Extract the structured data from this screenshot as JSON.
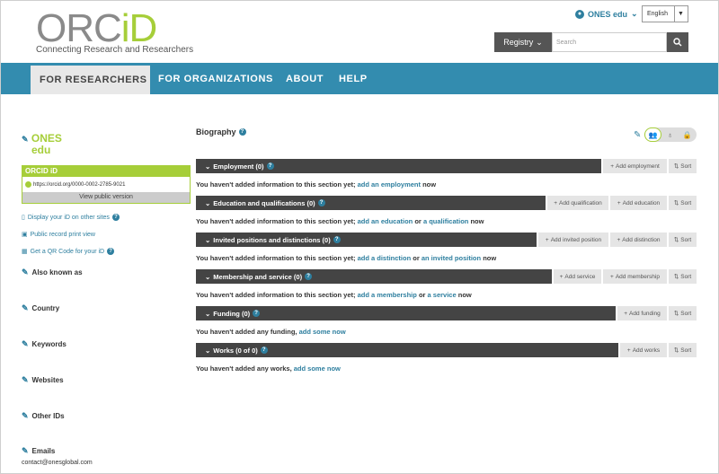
{
  "header": {
    "logo_text_gray": "ORC",
    "logo_text_green": "iD",
    "tagline": "Connecting Research and Researchers",
    "user_name": "ONES edu",
    "language": "English",
    "registry_label": "Registry",
    "search_placeholder": "Search"
  },
  "nav": {
    "items": [
      "FOR RESEARCHERS",
      "FOR ORGANIZATIONS",
      "ABOUT",
      "HELP"
    ]
  },
  "sidebar": {
    "name_line1": "ONES",
    "name_line2": "edu",
    "orcid_title": "ORCID iD",
    "orcid_url": "https://orcid.org/0000-0002-2785-9021",
    "view_public": "View public version",
    "links": [
      "Display your iD on other sites",
      "Public record print view",
      "Get a QR Code for your iD"
    ],
    "sections": [
      "Also known as",
      "Country",
      "Keywords",
      "Websites",
      "Other IDs",
      "Emails"
    ],
    "email": "contact@onesglobal.com"
  },
  "main": {
    "biography": "Biography",
    "sections": [
      {
        "title": "Employment (0)",
        "btns": [
          "Add employment",
          "Sort"
        ],
        "msg_prefix": "You haven't added information to this section yet; ",
        "link1": "add an employment",
        "mid": "",
        "link2": "",
        "suffix": " now"
      },
      {
        "title": "Education and qualifications (0)",
        "btns": [
          "Add qualification",
          "Add education",
          "Sort"
        ],
        "msg_prefix": "You haven't added information to this section yet; ",
        "link1": "add an education",
        "mid": " or ",
        "link2": "a qualification",
        "suffix": " now"
      },
      {
        "title": "Invited positions and distinctions (0)",
        "btns": [
          "Add invited position",
          "Add distinction",
          "Sort"
        ],
        "msg_prefix": "You haven't added information to this section yet; ",
        "link1": "add a distinction",
        "mid": " or ",
        "link2": "an invited position",
        "suffix": " now"
      },
      {
        "title": "Membership and service (0)",
        "btns": [
          "Add service",
          "Add membership",
          "Sort"
        ],
        "msg_prefix": "You haven't added information to this section yet; ",
        "link1": "add a membership",
        "mid": " or ",
        "link2": "a service",
        "suffix": " now"
      },
      {
        "title": "Funding (0)",
        "btns": [
          "Add funding",
          "Sort"
        ],
        "msg_prefix": "You haven't added any funding, ",
        "link1": "add some now",
        "mid": "",
        "link2": "",
        "suffix": ""
      },
      {
        "title": "Works (0 of 0)",
        "btns": [
          "Add works",
          "Sort"
        ],
        "msg_prefix": "You haven't added any works, ",
        "link1": "add some now",
        "mid": "",
        "link2": "",
        "suffix": ""
      }
    ]
  },
  "colors": {
    "brand_green": "#a6ce39",
    "nav_blue": "#338caf",
    "link_blue": "#2e7f9f",
    "bar_dark": "#444444"
  }
}
